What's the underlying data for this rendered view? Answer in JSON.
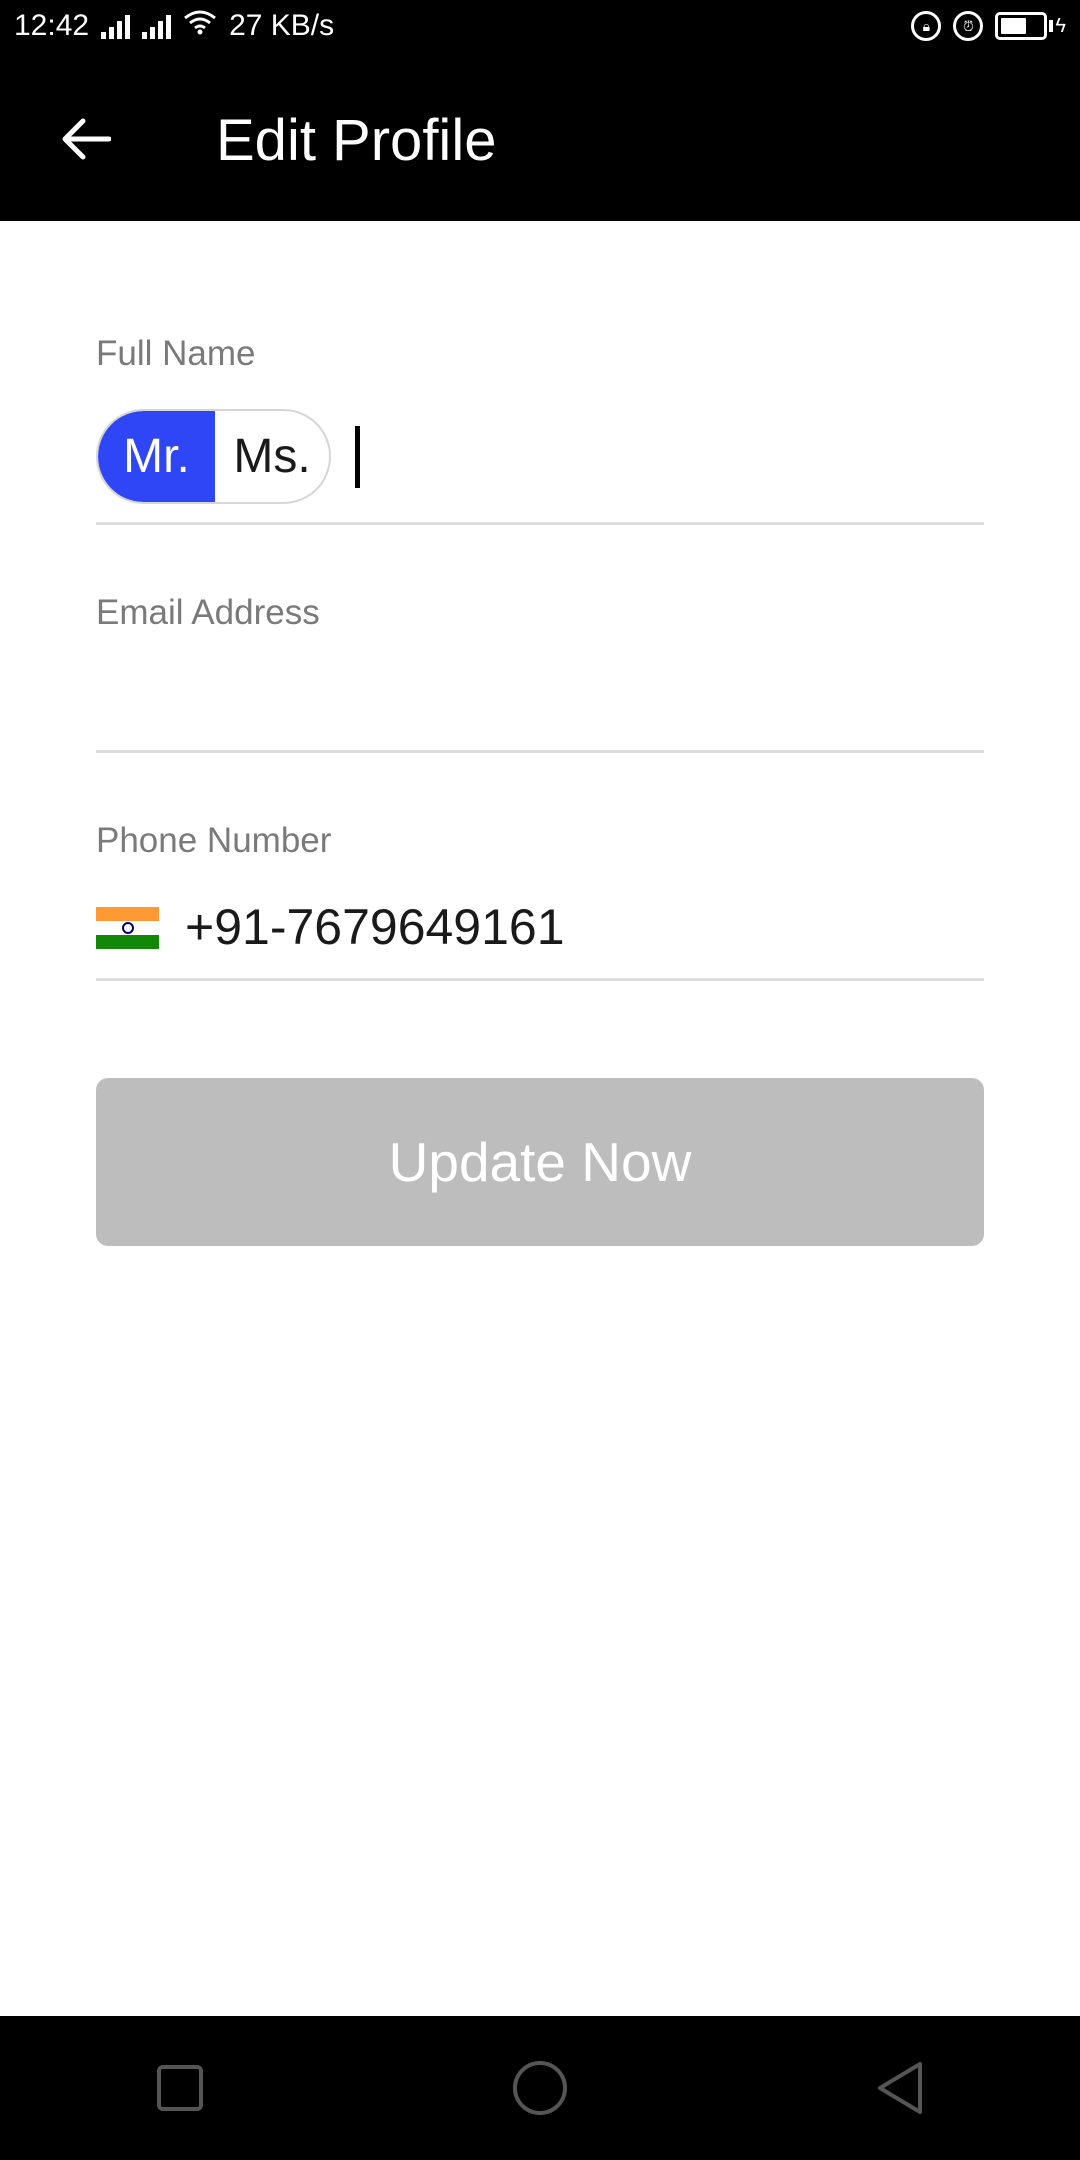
{
  "status_bar": {
    "time": "12:42",
    "net_speed": "27 KB/s"
  },
  "header": {
    "title": "Edit Profile"
  },
  "form": {
    "full_name": {
      "label": "Full Name",
      "title_options": [
        "Mr.",
        "Ms."
      ],
      "selected_title": "Mr.",
      "value": ""
    },
    "email": {
      "label": "Email Address",
      "value": ""
    },
    "phone": {
      "label": "Phone Number",
      "value": "+91-7679649161",
      "country_flag": "india-flag"
    },
    "submit_label": "Update Now"
  },
  "colors": {
    "accent": "#2f46f7",
    "button_disabled": "#bdbdbd",
    "bars": "#000000"
  },
  "icons": {
    "back": "arrow-left-icon",
    "nav_recent": "square-icon",
    "nav_home": "circle-icon",
    "nav_back": "triangle-back-icon"
  }
}
